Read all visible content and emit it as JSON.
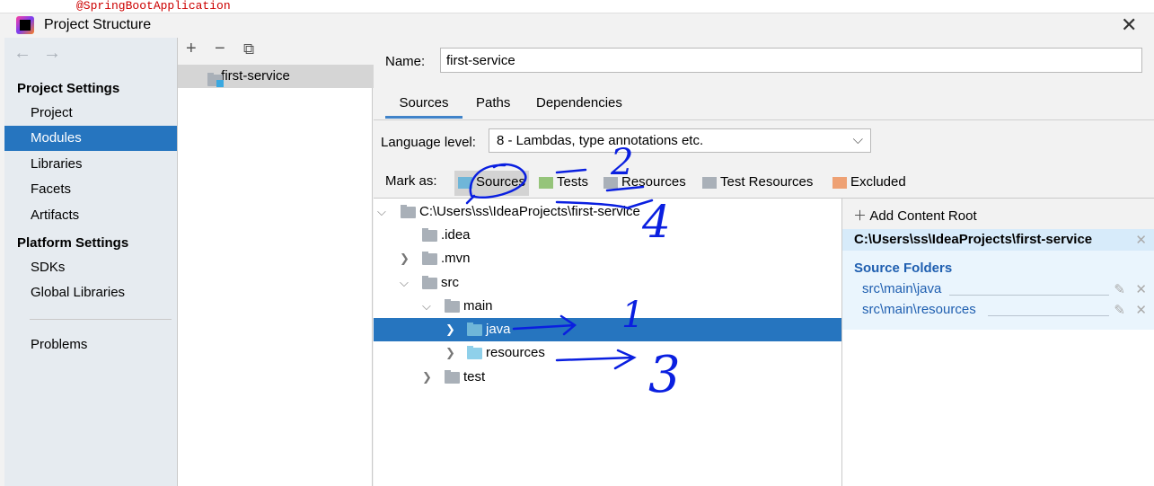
{
  "editor_bg_text": "@SpringBootApplication",
  "window": {
    "title": "Project Structure",
    "close": "✕"
  },
  "sidebar": {
    "back": "←",
    "forward": "→",
    "project_settings": "Project Settings",
    "items": [
      {
        "label": "Project"
      },
      {
        "label": "Modules"
      },
      {
        "label": "Libraries"
      },
      {
        "label": "Facets"
      },
      {
        "label": "Artifacts"
      }
    ],
    "platform_settings": "Platform Settings",
    "platform_items": [
      {
        "label": "SDKs"
      },
      {
        "label": "Global Libraries"
      }
    ],
    "problems": "Problems"
  },
  "modules": {
    "add": "+",
    "remove": "−",
    "copy": "⧉",
    "items": [
      {
        "label": "first-service"
      }
    ]
  },
  "name": {
    "label": "Name:",
    "value": "first-service"
  },
  "tabs": [
    {
      "label": "Sources"
    },
    {
      "label": "Paths"
    },
    {
      "label": "Dependencies"
    }
  ],
  "language": {
    "label": "Language level:",
    "value": "8 - Lambdas, type annotations etc."
  },
  "mark_as": {
    "label": "Mark as:",
    "options": [
      {
        "label": "Sources",
        "color": "#6fb6d8"
      },
      {
        "label": "Tests",
        "color": "#95c47a"
      },
      {
        "label": "Resources",
        "color": "#a9b0b8"
      },
      {
        "label": "Test Resources",
        "color": "#a9b0b8"
      },
      {
        "label": "Excluded",
        "color": "#eea174"
      }
    ]
  },
  "tree": [
    {
      "label": "C:\\Users\\ss\\IdeaProjects\\first-service",
      "expanded": true
    },
    {
      "label": ".idea"
    },
    {
      "label": ".mvn",
      "expanded": false
    },
    {
      "label": "src",
      "expanded": true
    },
    {
      "label": "main",
      "expanded": true
    },
    {
      "label": "java",
      "expanded": false,
      "selected": true
    },
    {
      "label": "resources",
      "expanded": false
    },
    {
      "label": "test",
      "expanded": false
    }
  ],
  "content_root": {
    "add_label": "Add Content Root",
    "path": "C:\\Users\\ss\\IdeaProjects\\first-service",
    "source_header": "Source Folders",
    "source_folders": [
      {
        "path": "src\\main\\java"
      },
      {
        "path": "src\\main\\resources"
      }
    ]
  },
  "annotations": {
    "n1": "1",
    "n2": "2",
    "n3": "3",
    "n4": "4"
  }
}
